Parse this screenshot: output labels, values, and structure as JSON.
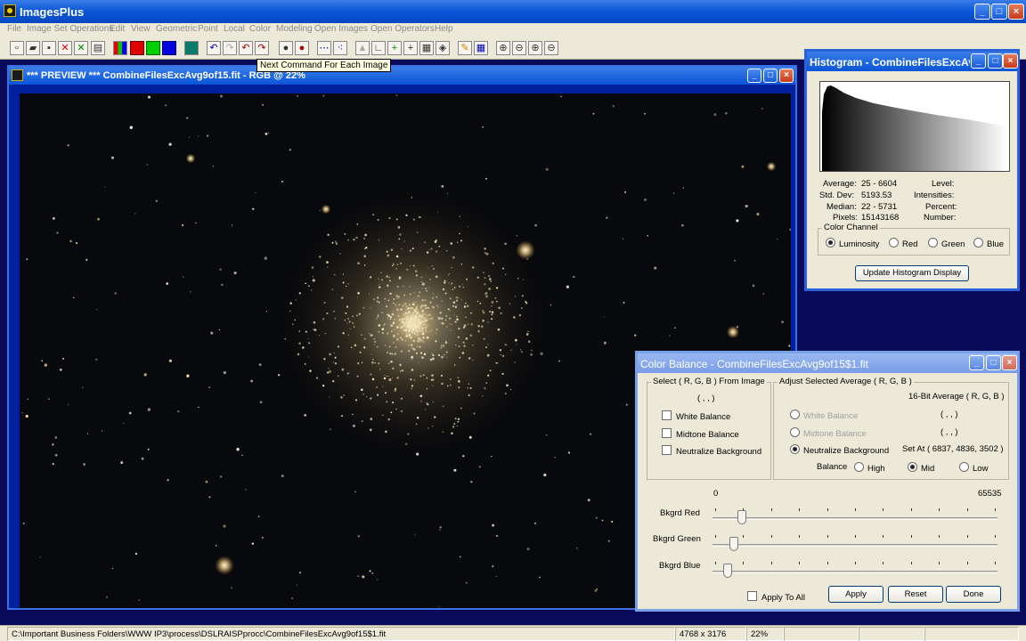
{
  "app": {
    "title": "ImagesPlus"
  },
  "menu": [
    "File",
    "Image Set Operations",
    "Edit",
    "View",
    "Geometric",
    "Point",
    "Local",
    "Color",
    "Modeling",
    "Open Images",
    "Open Operators",
    "Help"
  ],
  "toolbar": {
    "tooltip": "Next Command For Each Image"
  },
  "preview": {
    "title": "*** PREVIEW *** CombineFilesExcAvg9of15.fit - RGB @ 22%"
  },
  "histogram": {
    "title": "Histogram - CombineFilesExcAvg...",
    "stats": {
      "average_label": "Average:",
      "average": "25 - 6604",
      "stddev_label": "Std. Dev:",
      "stddev": "5193.53",
      "median_label": "Median:",
      "median": "22 - 5731",
      "pixels_label": "Pixels:",
      "pixels": "15143168",
      "level_label": "Level:",
      "intensities_label": "Intensities:",
      "percent_label": "Percent:",
      "number_label": "Number:"
    },
    "channel_group": "Color Channel",
    "channels": [
      "Luminosity",
      "Red",
      "Green",
      "Blue"
    ],
    "selected_channel": "Luminosity",
    "update_button": "Update Histogram Display"
  },
  "color_balance": {
    "title": "Color Balance - CombineFilesExcAvg9of15$1.fit",
    "select_group": "Select ( R, G, B ) From Image",
    "select_value": "( , , )",
    "checks": [
      "White Balance",
      "Midtone Balance",
      "Neutralize Background"
    ],
    "adjust_group": "Adjust Selected Average ( R, G, B )",
    "avg_header": "16-Bit Average ( R, G, B )",
    "radios": [
      "White Balance",
      "Midtone Balance",
      "Neutralize Background"
    ],
    "white_value": "( , , )",
    "midtone_value": "( , , )",
    "set_at": "Set At ( 6837, 4836, 3502 )",
    "balance_label": "Balance",
    "balance_options": [
      "High",
      "Mid",
      "Low"
    ],
    "balance_selected": "Mid",
    "range_min": "0",
    "range_max": "65535",
    "sliders": [
      {
        "label": "Bkgrd Red",
        "value": 6837
      },
      {
        "label": "Bkgrd Green",
        "value": 4836
      },
      {
        "label": "Bkgrd Blue",
        "value": 3502
      }
    ],
    "apply_to_all": "Apply To All",
    "apply_button": "Apply",
    "reset_button": "Reset",
    "done_button": "Done"
  },
  "status": {
    "path": "C:\\Important Business Folders\\WWW IP3\\process\\DSLRAISPprocc\\CombineFilesExcAvg9of15$1.fit",
    "dimensions": "4768 x 3176",
    "zoom": "22%"
  }
}
